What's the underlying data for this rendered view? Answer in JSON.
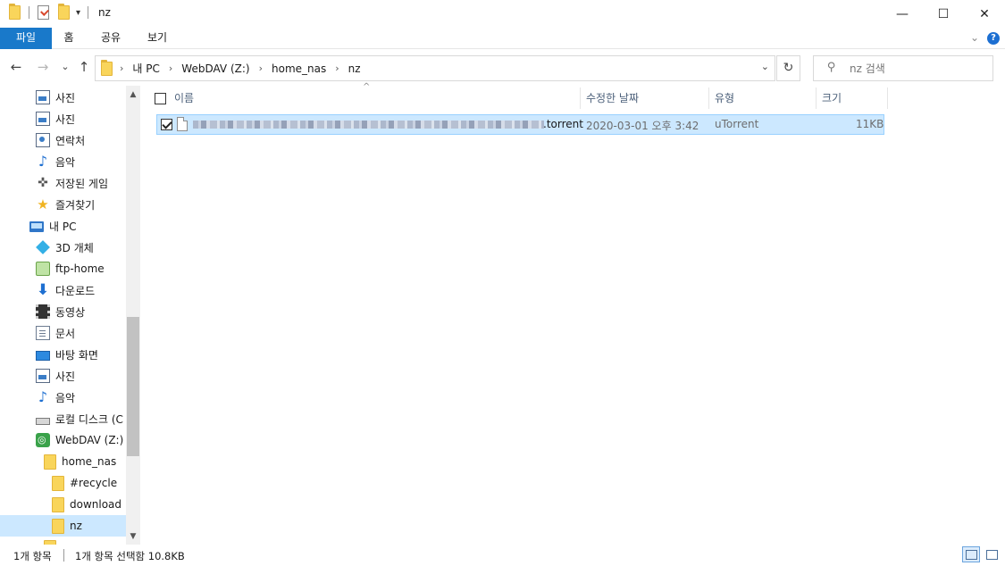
{
  "window": {
    "title": "nz",
    "minimize": "—",
    "maximize": "☐",
    "close": "✕"
  },
  "ribbon": {
    "tabs": [
      "파일",
      "홈",
      "공유",
      "보기"
    ],
    "expand": "⌄",
    "help": "?"
  },
  "nav": {
    "back": "←",
    "forward": "→",
    "recent": "⌄",
    "up": "↑",
    "breadcrumb": [
      "내 PC",
      "WebDAV (Z:)",
      "home_nas",
      "nz"
    ],
    "dropdown": "⌄",
    "refresh": "↻",
    "search_placeholder": "nz 검색"
  },
  "navpane": {
    "items": [
      {
        "label": "사진",
        "icon": "photo-icon"
      },
      {
        "label": "사진",
        "icon": "photo-icon"
      },
      {
        "label": "연락처",
        "icon": "contacts-icon"
      },
      {
        "label": "음악",
        "icon": "music-icon"
      },
      {
        "label": "저장된 게임",
        "icon": "saved-games-icon"
      },
      {
        "label": "즐겨찾기",
        "icon": "favorites-star-icon"
      },
      {
        "label": "내 PC",
        "icon": "computer-icon"
      },
      {
        "label": "3D 개체",
        "icon": "3d-objects-icon"
      },
      {
        "label": "ftp-home",
        "icon": "network-location-icon"
      },
      {
        "label": "다운로드",
        "icon": "download-arrow-icon"
      },
      {
        "label": "동영상",
        "icon": "video-icon"
      },
      {
        "label": "문서",
        "icon": "document-icon"
      },
      {
        "label": "바탕 화면",
        "icon": "desktop-icon"
      },
      {
        "label": "사진",
        "icon": "photo-icon"
      },
      {
        "label": "음악",
        "icon": "music-icon"
      },
      {
        "label": "로컬 디스크 (C",
        "icon": "local-disk-icon"
      },
      {
        "label": "WebDAV (Z:)",
        "icon": "webdav-drive-icon"
      },
      {
        "label": "home_nas",
        "icon": "folder-icon"
      },
      {
        "label": "#recycle",
        "icon": "folder-icon"
      },
      {
        "label": "download",
        "icon": "folder-icon"
      },
      {
        "label": "nz",
        "icon": "folder-icon"
      }
    ]
  },
  "columns": {
    "name": "이름",
    "modified": "수정한 날짜",
    "type": "유형",
    "size": "크기"
  },
  "files": [
    {
      "name_suffix": ".torrent",
      "modified": "2020-03-01 오후 3:42",
      "type": "uTorrent",
      "size": "11KB",
      "selected": true
    }
  ],
  "status": {
    "item_count": "1개 항목",
    "selection": "1개 항목 선택함 10.8KB"
  },
  "colors": {
    "accent": "#1979ca",
    "selection": "#cce8ff",
    "selection_border": "#99d1ff"
  }
}
